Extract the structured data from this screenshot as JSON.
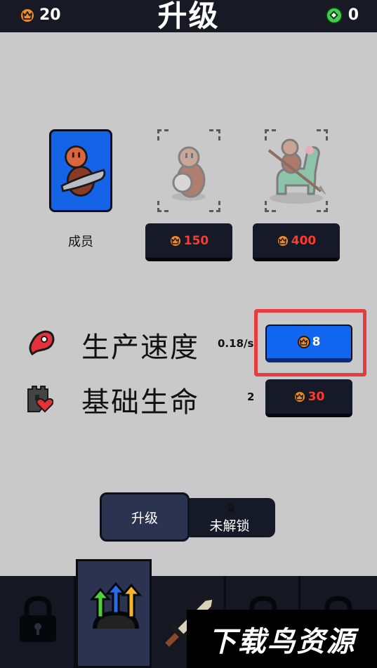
{
  "header": {
    "title": "升级",
    "crowns": "20",
    "gems": "0"
  },
  "units": [
    {
      "name": "成员",
      "state": "selected",
      "price": ""
    },
    {
      "name": "",
      "state": "locked",
      "price": "150"
    },
    {
      "name": "",
      "state": "locked",
      "price": "400"
    }
  ],
  "stats": [
    {
      "label": "生产速度",
      "value": "0.18/s",
      "cost": "8",
      "icon": "meat-icon",
      "highlighted": true
    },
    {
      "label": "基础生命",
      "value": "2",
      "cost": "30",
      "icon": "castle-heart-icon",
      "highlighted": false
    }
  ],
  "tabs": {
    "upgrade": "升级",
    "locked": "未解锁"
  },
  "bottom_nav": [
    "lock-icon",
    "upgrade-arrows-icon",
    "sword-icon",
    "lock-icon",
    "lock-icon"
  ],
  "watermark": "下载鸟资源",
  "colors": {
    "accent_blue": "#1166f0",
    "price_red": "#ff3a2a",
    "highlight_red": "#e63b3f",
    "coin_orange": "#f08a2c",
    "gem_green": "#3fcf4c"
  }
}
